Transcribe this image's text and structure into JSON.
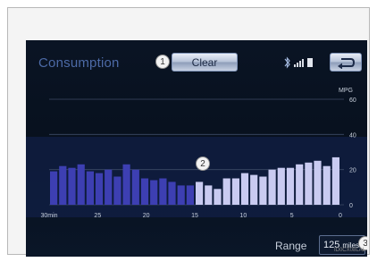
{
  "screen": {
    "title": "Consumption",
    "clear_label": "Clear",
    "back_icon": "back-arrow-icon",
    "status_icons": [
      "bluetooth-icon",
      "signal-bars-icon",
      "battery-icon"
    ]
  },
  "callouts": [
    "1",
    "2",
    "3"
  ],
  "chart_data": {
    "type": "bar",
    "ylabel": "MPG",
    "ylim": [
      0,
      60
    ],
    "yticks": [
      "60",
      "40",
      "20",
      "0"
    ],
    "xticks": [
      "30min",
      "25",
      "20",
      "15",
      "10",
      "5",
      "0"
    ],
    "x_range": [
      30,
      0
    ],
    "bar_colors": {
      "past": "#3d3fb2",
      "recent": "#c9cbf1"
    },
    "values": [
      19,
      22,
      21,
      23,
      19,
      18,
      20,
      16,
      23,
      20,
      15,
      14,
      15,
      13,
      11,
      11,
      13,
      11,
      9,
      15,
      15,
      18,
      17,
      16,
      20,
      21,
      21,
      23,
      24,
      25,
      22,
      27
    ],
    "split_index": 16
  },
  "range": {
    "label": "Range",
    "value": "125",
    "unit": "miles"
  },
  "image_code": "ID0CX08LAL"
}
